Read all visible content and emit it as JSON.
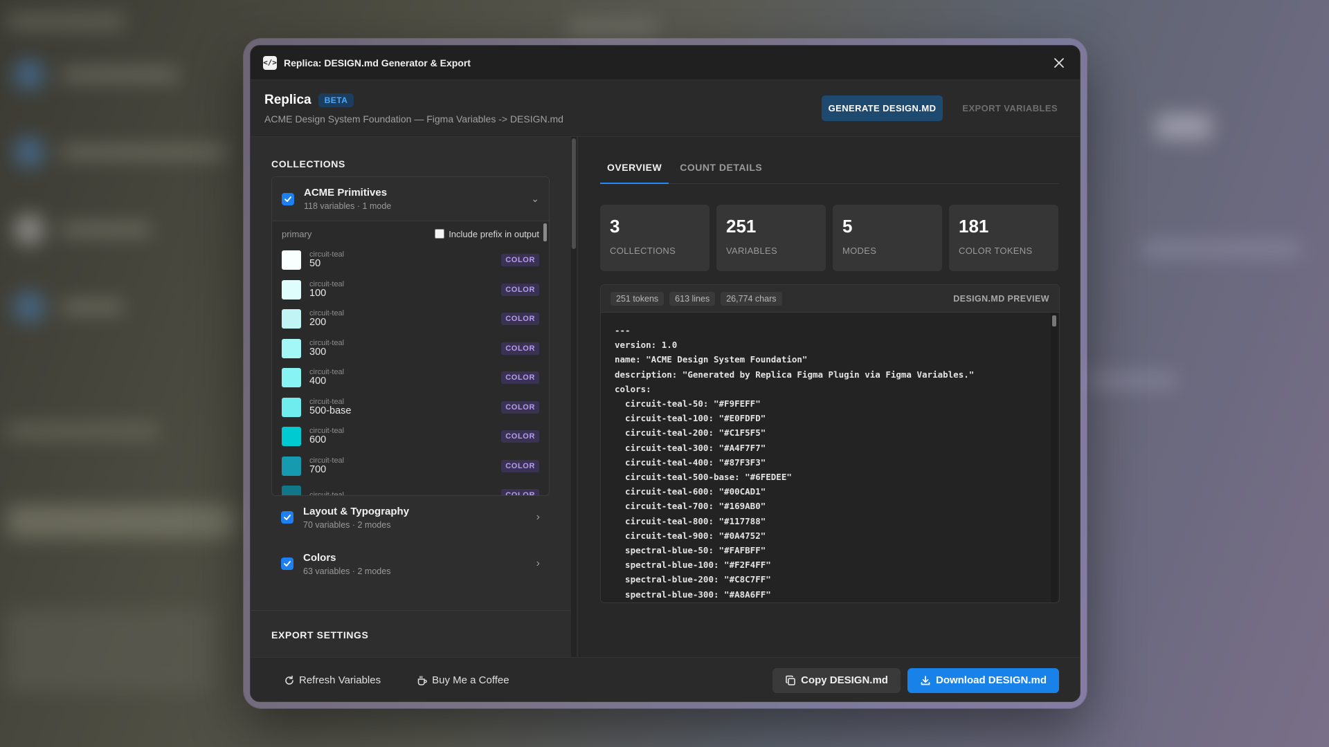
{
  "window": {
    "title": "Replica: DESIGN.md Generator & Export",
    "icon": "code-icon"
  },
  "header": {
    "brand": "Replica",
    "badge": "BETA",
    "subtitle": "ACME Design System Foundation — Figma Variables -> DESIGN.md",
    "generate_label": "GENERATE DESIGN.MD",
    "export_label": "EXPORT VARIABLES"
  },
  "collections": {
    "title": "COLLECTIONS",
    "expanded": {
      "name": "ACME Primitives",
      "meta": "118 variables · 1 mode",
      "group": "primary",
      "prefix_label": "Include prefix in output",
      "variables": [
        {
          "group": "circuit-teal",
          "name": "50",
          "type": "COLOR",
          "color": "#F9FEFF"
        },
        {
          "group": "circuit-teal",
          "name": "100",
          "type": "COLOR",
          "color": "#E0FDFD"
        },
        {
          "group": "circuit-teal",
          "name": "200",
          "type": "COLOR",
          "color": "#C1F5F5"
        },
        {
          "group": "circuit-teal",
          "name": "300",
          "type": "COLOR",
          "color": "#A4F7F7"
        },
        {
          "group": "circuit-teal",
          "name": "400",
          "type": "COLOR",
          "color": "#87F3F3"
        },
        {
          "group": "circuit-teal",
          "name": "500-base",
          "type": "COLOR",
          "color": "#6FEDEE"
        },
        {
          "group": "circuit-teal",
          "name": "600",
          "type": "COLOR",
          "color": "#00CAD1"
        },
        {
          "group": "circuit-teal",
          "name": "700",
          "type": "COLOR",
          "color": "#169AB0"
        },
        {
          "group": "circuit-teal",
          "name": "",
          "type": "COLOR",
          "color": "#117788"
        }
      ]
    },
    "others": [
      {
        "name": "Layout & Typography",
        "meta": "70 variables · 2 modes"
      },
      {
        "name": "Colors",
        "meta": "63 variables · 2 modes"
      }
    ]
  },
  "export_settings": {
    "title": "EXPORT SETTINGS"
  },
  "tabs": [
    "OVERVIEW",
    "COUNT DETAILS"
  ],
  "stats": [
    {
      "value": "3",
      "label": "COLLECTIONS"
    },
    {
      "value": "251",
      "label": "VARIABLES"
    },
    {
      "value": "5",
      "label": "MODES"
    },
    {
      "value": "181",
      "label": "COLOR TOKENS"
    }
  ],
  "preview": {
    "pills": [
      "251 tokens",
      "613 lines",
      "26,774 chars"
    ],
    "label": "DESIGN.MD PREVIEW",
    "code": "---\nversion: 1.0\nname: \"ACME Design System Foundation\"\ndescription: \"Generated by Replica Figma Plugin via Figma Variables.\"\ncolors:\n  circuit-teal-50: \"#F9FEFF\"\n  circuit-teal-100: \"#E0FDFD\"\n  circuit-teal-200: \"#C1F5F5\"\n  circuit-teal-300: \"#A4F7F7\"\n  circuit-teal-400: \"#87F3F3\"\n  circuit-teal-500-base: \"#6FEDEE\"\n  circuit-teal-600: \"#00CAD1\"\n  circuit-teal-700: \"#169AB0\"\n  circuit-teal-800: \"#117788\"\n  circuit-teal-900: \"#0A4752\"\n  spectral-blue-50: \"#FAFBFF\"\n  spectral-blue-100: \"#F2F4FF\"\n  spectral-blue-200: \"#C8C7FF\"\n  spectral-blue-300: \"#A8A6FF\""
  },
  "footer": {
    "refresh_label": "Refresh Variables",
    "coffee_label": "Buy Me a Coffee",
    "copy_label": "Copy DESIGN.md",
    "download_label": "Download DESIGN.md"
  },
  "colors": {
    "accent": "#1882E8",
    "tag_bg": "#3A3252",
    "tag_fg": "#B59CF0",
    "checkbox": "#1E7FF0"
  }
}
